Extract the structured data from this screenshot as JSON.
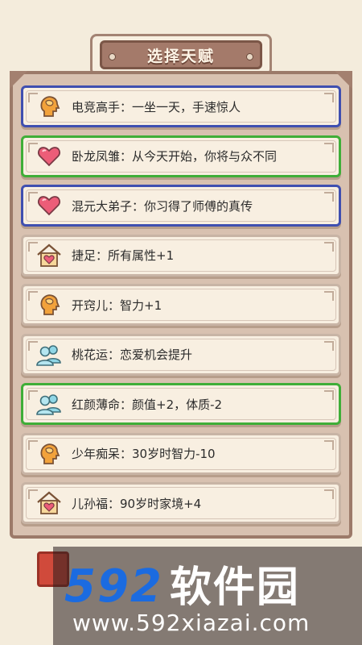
{
  "header": {
    "title": "选择天赋"
  },
  "talents": [
    {
      "label": "电竞高手：一坐一天，手速惊人",
      "icon": "brain-head-icon",
      "rarity": "blue"
    },
    {
      "label": "卧龙凤雏：从今天开始，你将与众不同",
      "icon": "heart-icon",
      "rarity": "green"
    },
    {
      "label": "混元大弟子：你习得了师傅的真传",
      "icon": "heart-icon",
      "rarity": "blue"
    },
    {
      "label": "捷足：所有属性+1",
      "icon": "house-heart-icon",
      "rarity": "normal"
    },
    {
      "label": "开窍儿：智力+1",
      "icon": "brain-head-icon",
      "rarity": "normal"
    },
    {
      "label": "桃花运：恋爱机会提升",
      "icon": "people-icon",
      "rarity": "normal"
    },
    {
      "label": "红颜薄命：颜值+2，体质-2",
      "icon": "people-icon",
      "rarity": "green"
    },
    {
      "label": "少年痴呆：30岁时智力-10",
      "icon": "brain-head-icon",
      "rarity": "normal"
    },
    {
      "label": "儿孙福：90岁时家境+4",
      "icon": "house-heart-icon",
      "rarity": "normal"
    }
  ],
  "watermark": {
    "logo_number": "592",
    "logo_text": "软件园",
    "url": "www.592xiazai.com"
  },
  "colors": {
    "blue_border": "#3f4fb0",
    "green_border": "#3fae38",
    "panel": "#d8c1b0",
    "banner": "#a47a6a"
  }
}
